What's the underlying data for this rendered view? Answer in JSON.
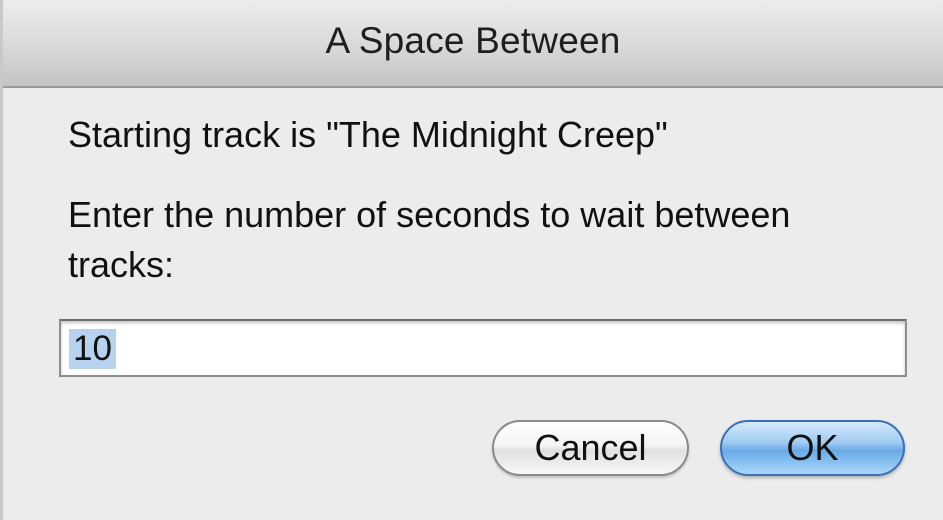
{
  "window": {
    "title": "A Space Between"
  },
  "message": {
    "starting_track": "Starting track is \"The Midnight Creep\"",
    "prompt": "Enter the number of seconds to wait between tracks:"
  },
  "input": {
    "value": "10"
  },
  "buttons": {
    "cancel": "Cancel",
    "ok": "OK"
  },
  "colors": {
    "dialog_bg": "#ececec",
    "selection_highlight": "#b6d2ee",
    "default_button": "#6aa9e6"
  }
}
